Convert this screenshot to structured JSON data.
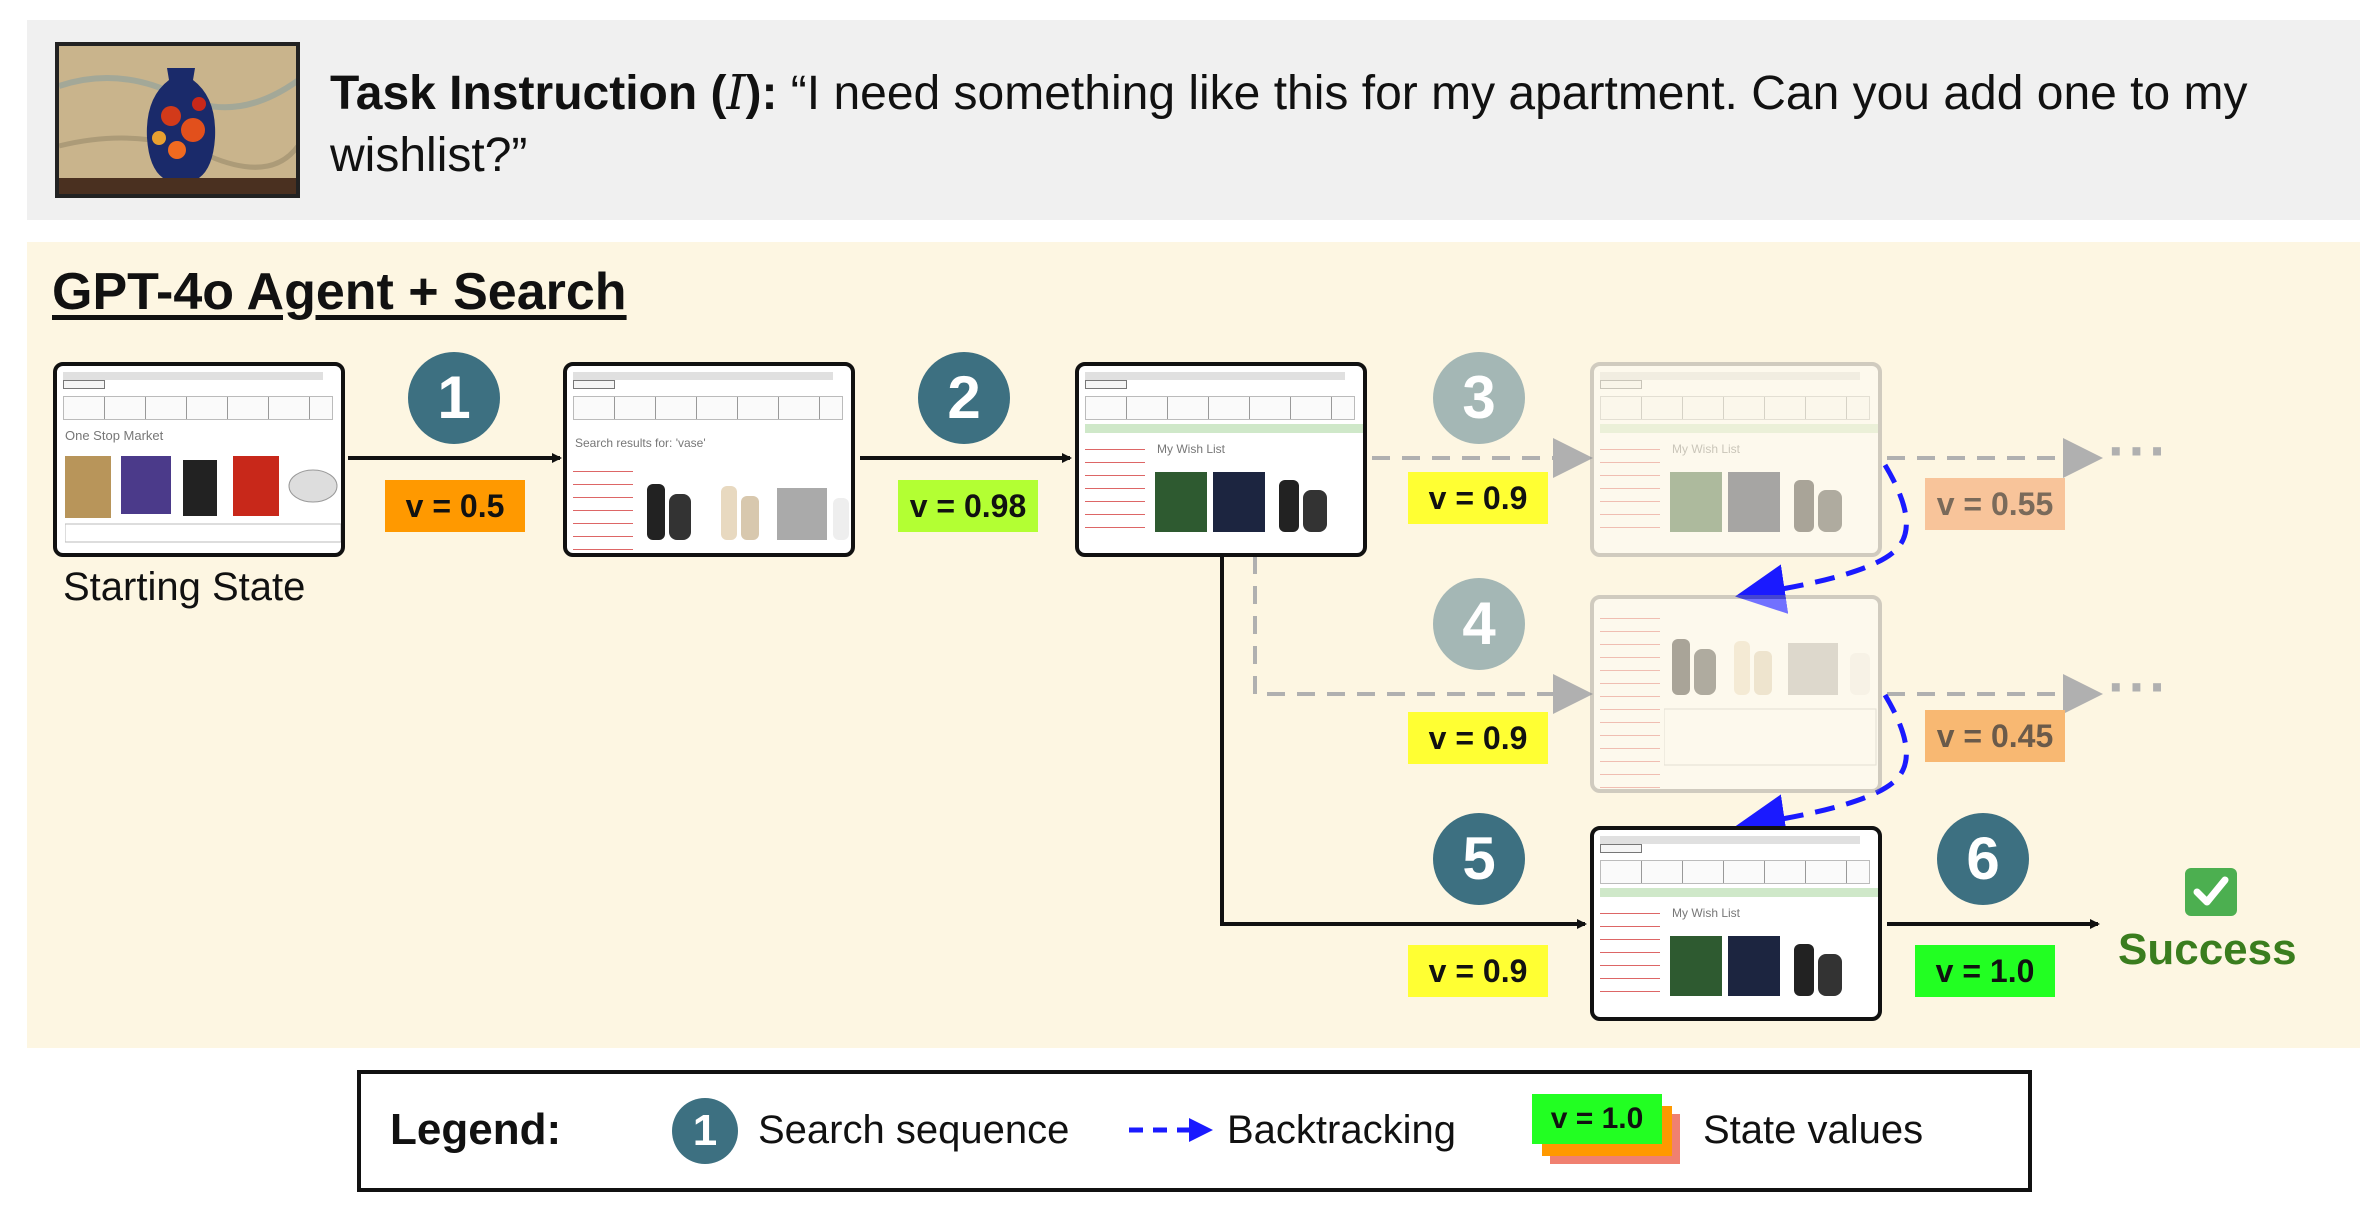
{
  "instruction": {
    "label": "Task Instruction (",
    "symbol": "I",
    "label_end": "):",
    "text": "“I need something like this for my apartment. Can you add one to my wishlist?”"
  },
  "panel": {
    "title": "GPT-4o Agent + Search"
  },
  "states": {
    "start": {
      "caption": "Starting State",
      "page_title": "One Stop Market",
      "logo": "One Stop Market"
    },
    "search": {
      "page_title": "Search results for: 'vase'"
    },
    "wishlist": {
      "page_title": "My Wish List"
    }
  },
  "steps": [
    "1",
    "2",
    "3",
    "4",
    "5",
    "6"
  ],
  "values": {
    "v1": "v = 0.5",
    "v2": "v = 0.98",
    "v3": "v = 0.9",
    "v3b": "v = 0.55",
    "v4": "v = 0.9",
    "v4b": "v = 0.45",
    "v5": "v = 0.9",
    "v6": "v = 1.0"
  },
  "value_colors": {
    "v1": "#ff9900",
    "v2": "#b3ff33",
    "v_yellow": "#ffff33",
    "v3b": "#f8c49a",
    "v4b": "#f8b872",
    "v6": "#22ff22"
  },
  "ellipsis": "···",
  "success": {
    "icon": "check-mark-icon",
    "label": "Success"
  },
  "legend": {
    "title": "Legend:",
    "step_example": "1",
    "search_sequence": "Search sequence",
    "backtracking": "Backtracking",
    "state_value_example": "v = 1.0",
    "state_values": "State values"
  },
  "colors": {
    "step_circle": "#3d7081",
    "step_circle_faded": "#a4b7b5",
    "backtrack": "#1a1aff",
    "success": "#3a7d1e",
    "panel_bg": "#fdf6e2",
    "banner_bg": "#f0f0f0"
  }
}
